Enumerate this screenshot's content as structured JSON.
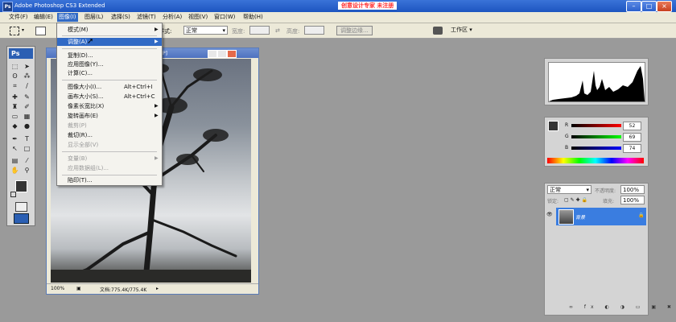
{
  "window": {
    "title": "Adobe Photoshop CS3 Extended",
    "watermark": "创意设计专家 未注册"
  },
  "menubar": [
    "文件(F)",
    "编辑(E)",
    "图像(I)",
    "图层(L)",
    "选择(S)",
    "滤镜(T)",
    "分析(A)",
    "视图(V)",
    "窗口(W)",
    "帮助(H)"
  ],
  "options": {
    "style_label": "样式:",
    "style_value": "正常",
    "width_label": "宽度:",
    "height_label": "高度:",
    "refine_label": "调整边缘...",
    "workspace_label": "工作区 ▾"
  },
  "document": {
    "zoom": "100%",
    "doc_size": "文档:775.4K/775.4K",
    "title_suffix": "P]"
  },
  "image_menu": {
    "items": [
      {
        "label": "模式(M)",
        "shortcut": "",
        "submenu": true,
        "disabled": false,
        "highlight": false
      },
      {
        "label": "调整(A)",
        "shortcut": "",
        "submenu": true,
        "disabled": false,
        "highlight": true
      },
      {
        "label": "复制(D)...",
        "shortcut": "",
        "submenu": false,
        "disabled": false,
        "highlight": false
      },
      {
        "label": "应用图像(Y)...",
        "shortcut": "",
        "submenu": false,
        "disabled": false,
        "highlight": false
      },
      {
        "label": "计算(C)...",
        "shortcut": "",
        "submenu": false,
        "disabled": false,
        "highlight": false
      },
      {
        "label": "图像大小(I)...",
        "shortcut": "Alt+Ctrl+I",
        "submenu": false,
        "disabled": false,
        "highlight": false
      },
      {
        "label": "画布大小(S)...",
        "shortcut": "Alt+Ctrl+C",
        "submenu": false,
        "disabled": false,
        "highlight": false
      },
      {
        "label": "像素长宽比(X)",
        "shortcut": "",
        "submenu": true,
        "disabled": false,
        "highlight": false
      },
      {
        "label": "旋转画布(E)",
        "shortcut": "",
        "submenu": true,
        "disabled": false,
        "highlight": false
      },
      {
        "label": "裁剪(P)",
        "shortcut": "",
        "submenu": false,
        "disabled": true,
        "highlight": false
      },
      {
        "label": "裁切(R)...",
        "shortcut": "",
        "submenu": false,
        "disabled": false,
        "highlight": false
      },
      {
        "label": "显示全部(V)",
        "shortcut": "",
        "submenu": false,
        "disabled": true,
        "highlight": false
      },
      {
        "label": "变量(B)",
        "shortcut": "",
        "submenu": true,
        "disabled": true,
        "highlight": false
      },
      {
        "label": "应用数据组(L)...",
        "shortcut": "",
        "submenu": false,
        "disabled": true,
        "highlight": false
      },
      {
        "label": "陷印(T)...",
        "shortcut": "",
        "submenu": false,
        "disabled": false,
        "highlight": false
      }
    ]
  },
  "color_panel": {
    "r_label": "R",
    "g_label": "G",
    "b_label": "B",
    "r": "52",
    "g": "69",
    "b": "74"
  },
  "layers_panel": {
    "blend_mode": "正常",
    "opacity_label": "不透明度:",
    "opacity": "100%",
    "lock_label": "锁定:",
    "fill_label": "填充:",
    "fill": "100%",
    "layer_name": "背景"
  }
}
